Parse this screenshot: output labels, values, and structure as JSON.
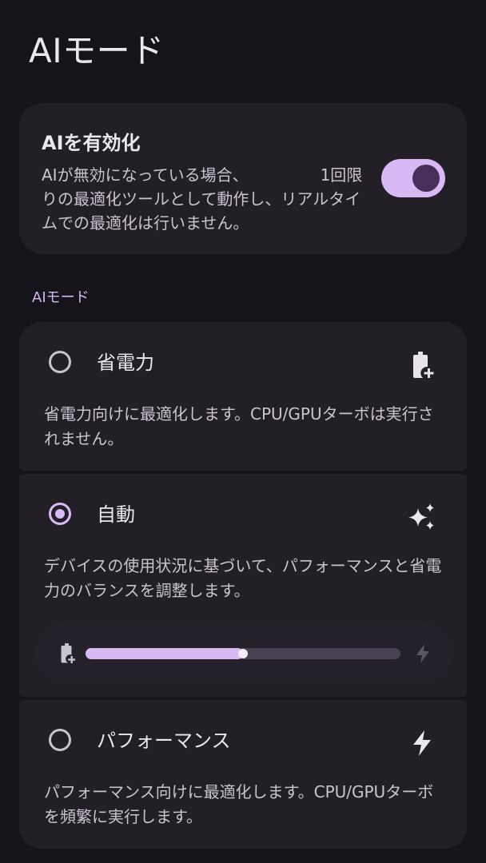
{
  "header": {
    "title": "AIモード"
  },
  "ai_toggle": {
    "title": "AIを有効化",
    "description": "AIが無効になっている場合、　　　　　1回限りの最適化ツールとして動作し、リアルタイムでの最適化は行いません。",
    "enabled": true
  },
  "section": {
    "label": "AIモード"
  },
  "modes": [
    {
      "title": "省電力",
      "description": "省電力向けに最適化します。CPU/GPUターボは実行されません。",
      "icon": "battery-charging-icon",
      "selected": false
    },
    {
      "title": "自動",
      "description": "デバイスの使用状況に基づいて、パフォーマンスと省電力のバランスを調整します。",
      "icon": "sparkle-icon",
      "selected": true,
      "slider": {
        "value": 0.5,
        "left_icon": "battery-charging-icon",
        "right_icon": "bolt-icon"
      }
    },
    {
      "title": "パフォーマンス",
      "description": "パフォーマンス向けに最適化します。CPU/GPUターボを頻繁に実行します。",
      "icon": "bolt-icon",
      "selected": false
    }
  ],
  "colors": {
    "background": "#16141a",
    "card": "#221f27",
    "accent": "#d9b9f3",
    "toggle_knob": "#472e5b"
  }
}
